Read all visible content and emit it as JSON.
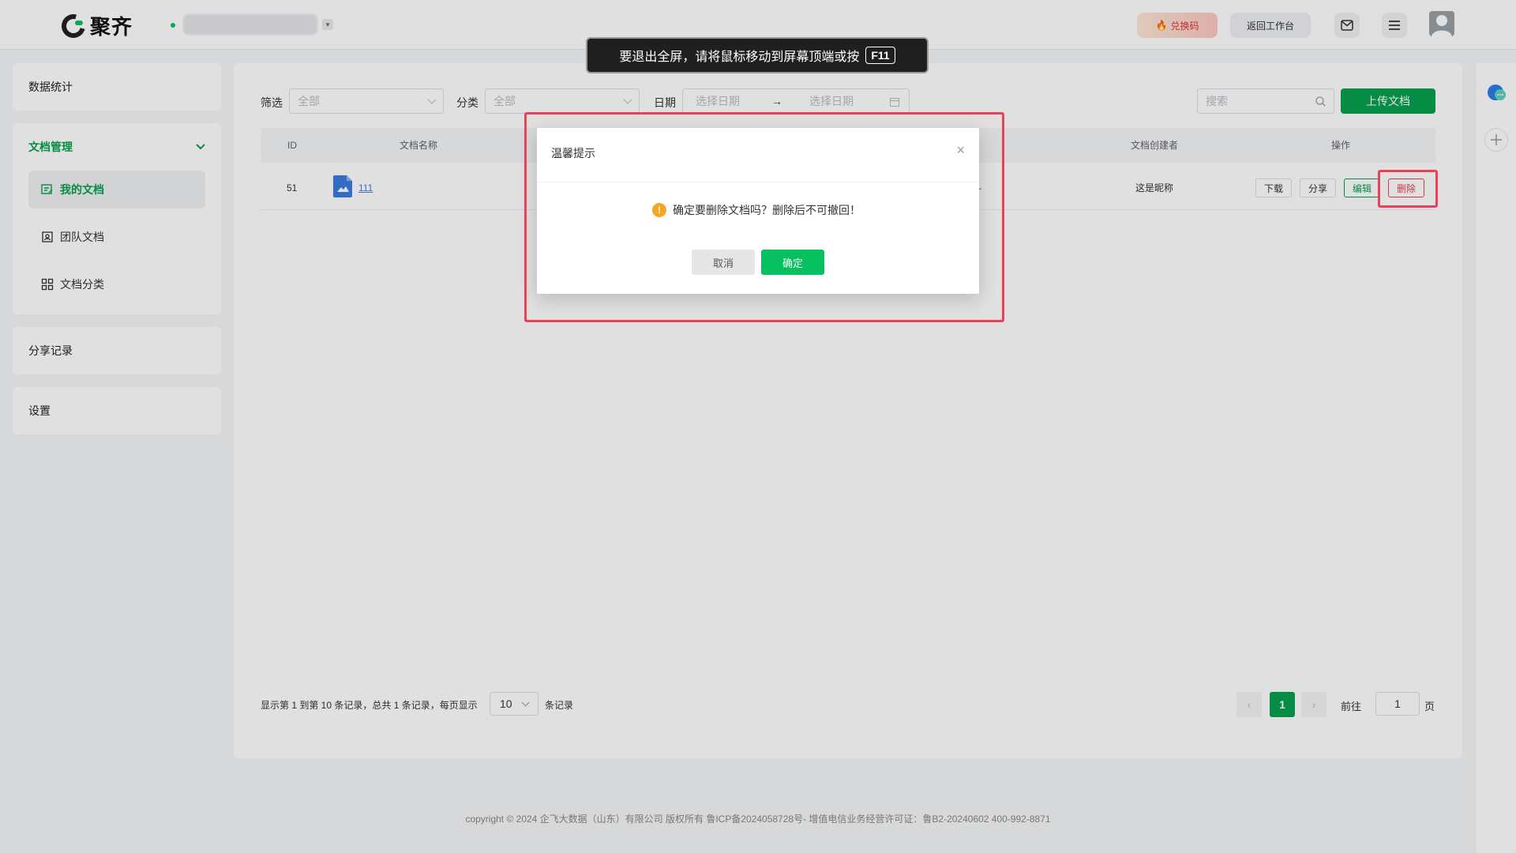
{
  "app": {
    "logo_text": "聚齐"
  },
  "header": {
    "redeem_label": "兑换码",
    "back_label": "返回工作台",
    "caret_glyph": "▾",
    "flame_glyph": "🔥"
  },
  "fullscreen_toast": {
    "text": "要退出全屏，请将鼠标移动到屏幕顶端或按",
    "key": "F11"
  },
  "sidebar": {
    "stats": "数据统计",
    "docs_group": "文档管理",
    "docs_items": [
      {
        "label": "我的文档",
        "icon": "my-docs-icon"
      },
      {
        "label": "团队文档",
        "icon": "team-docs-icon"
      },
      {
        "label": "文档分类",
        "icon": "category-icon"
      }
    ],
    "share_records": "分享记录",
    "settings": "设置"
  },
  "filters": {
    "filter_label": "筛选",
    "filter_value": "全部",
    "category_label": "分类",
    "category_value": "全部",
    "date_label": "日期",
    "date_start_placeholder": "选择日期",
    "date_arrow": "→",
    "date_end_placeholder": "选择日期",
    "search_placeholder": "搜索",
    "upload_label": "上传文档"
  },
  "table": {
    "columns": {
      "id": "ID",
      "name": "文档名称",
      "creator": "文档创建者",
      "ops": "操作"
    },
    "rows": [
      {
        "id": "51",
        "name": "111",
        "creator": "这是昵称",
        "hidden_cell": "–"
      }
    ],
    "ops": {
      "download": "下载",
      "share": "分享",
      "edit": "编辑",
      "delete": "删除"
    }
  },
  "pagination": {
    "summary": "显示第 1 到第 10 条记录，总共 1 条记录，每页显示",
    "page_size": "10",
    "page_size_suffix": "条记录",
    "prev_glyph": "‹",
    "current_page": "1",
    "next_glyph": "›",
    "goto_label": "前往",
    "goto_value": "1",
    "page_suffix": "页"
  },
  "footer": {
    "text": "copyright © 2024 企飞大数据（山东）有限公司 版权所有   鲁ICP备2024058728号-  增值电信业务经营许可证：鲁B2-20240602  400-992-8871"
  },
  "dialog": {
    "title": "温馨提示",
    "close_glyph": "×",
    "warn_glyph": "!",
    "message": "确定要删除文档吗？删除后不可撤回！",
    "cancel_label": "取消",
    "confirm_label": "确定"
  },
  "colors": {
    "accent": "#07a04f",
    "highlight": "#e8415a",
    "warning": "#f5a623"
  }
}
